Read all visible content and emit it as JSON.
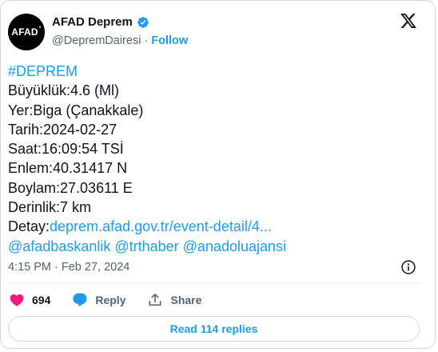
{
  "account": {
    "avatar_text": "AFAD",
    "display_name": "AFAD Deprem",
    "handle": "@DepremDairesi",
    "separator": "·",
    "follow_label": "Follow"
  },
  "tweet": {
    "hashtag": "#DEPREM",
    "magnitude": "Büyüklük:4.6 (Ml)",
    "location": "Yer:Biga (Çanakkale)",
    "date": "Tarih:2024-02-27",
    "time": "Saat:16:09:54 TSİ",
    "latitude": "Enlem:40.31417 N",
    "longitude": "Boylam:27.03611 E",
    "depth": "Derinlik:7 km",
    "detail_label": "Detay:",
    "detail_link": "deprem.afad.gov.tr/event-detail/4...",
    "mentions": "@afadbaskanlik @trthaber @anadoluajansi"
  },
  "meta": {
    "timestamp": "4:15 PM · Feb 27, 2024"
  },
  "actions": {
    "like_count": "694",
    "reply_label": "Reply",
    "share_label": "Share"
  },
  "read_replies_label": "Read 114 replies",
  "icons": [
    "verified-icon",
    "x-logo-icon",
    "info-icon",
    "heart-icon",
    "reply-icon",
    "share-icon"
  ],
  "colors": {
    "link": "#1d9bf0",
    "like": "#f91880",
    "text": "#0f1419",
    "secondary": "#536471"
  }
}
